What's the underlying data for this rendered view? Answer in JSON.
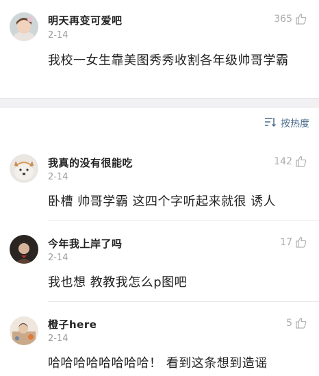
{
  "comments": [
    {
      "username": "明天再变可爱吧",
      "date": "2-14",
      "likes": "365",
      "text": "我校一女生靠美图秀秀收割各年级帅哥学霸"
    },
    {
      "username": "我真的没有很能吃",
      "date": "2-14",
      "likes": "142",
      "text": "卧槽 帅哥学霸 这四个字听起来就很 诱人"
    },
    {
      "username": "今年我上岸了吗",
      "date": "2-14",
      "likes": "17",
      "text": "我也想 教教我怎么p图吧"
    },
    {
      "username": "橙子here",
      "date": "2-14",
      "likes": "5",
      "text": "哈哈哈哈哈哈哈哈！ 看到这条想到造谣"
    }
  ],
  "sort": {
    "label": "按热度",
    "icon": "sort-icon"
  },
  "icons": {
    "like": "thumbs-up-icon"
  },
  "colors": {
    "link": "#4a6b8c",
    "muted": "#999999",
    "band": "#f1f1f3"
  }
}
